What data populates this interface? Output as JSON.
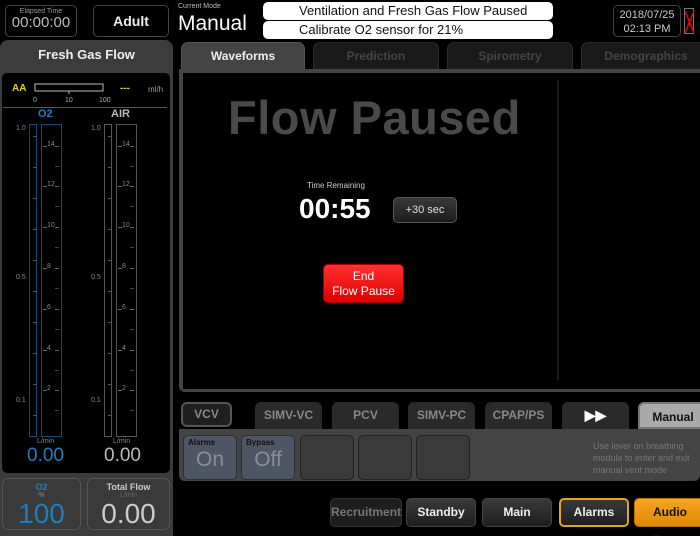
{
  "header": {
    "elapsed_label": "Elapsed Time",
    "elapsed_value": "00:00:00",
    "patient_type": "Adult",
    "mode_label": "Current Mode",
    "mode_value": "Manual",
    "messages": [
      "Ventilation and Fresh Gas Flow Paused",
      "Calibrate O2 sensor for 21%"
    ],
    "date": "2018/07/25",
    "time": "02:13 PM",
    "battery_icon": "battery-missing-icon"
  },
  "fresh_gas_flow": {
    "title": "Fresh Gas Flow",
    "agent": {
      "label": "AA",
      "value": "---",
      "unit": "ml/h",
      "scale_ticks": [
        "0",
        "10",
        "100"
      ]
    },
    "gauges": [
      {
        "name": "O2",
        "color": "#1b7fbf",
        "left_ticks": [
          "1.0",
          "0.5",
          "0.1"
        ],
        "right_ticks": [
          "14",
          "12",
          "10",
          "8",
          "6",
          "4",
          "2"
        ],
        "unit": "L/min",
        "value": "0.00"
      },
      {
        "name": "AIR",
        "color": "#bbbbbb",
        "left_ticks": [
          "1.0",
          "0.5",
          "0.1"
        ],
        "right_ticks": [
          "14",
          "12",
          "10",
          "8",
          "6",
          "4",
          "2"
        ],
        "unit": "L/min",
        "value": "0.00"
      }
    ],
    "o2_percent": {
      "title": "O2",
      "unit": "%",
      "value": "100"
    },
    "total_flow": {
      "title": "Total Flow",
      "unit": "L/min",
      "value": "0.00"
    }
  },
  "tabs": [
    {
      "label": "Waveforms",
      "active": true
    },
    {
      "label": "Prediction",
      "active": false
    },
    {
      "label": "Spirometry",
      "active": false
    },
    {
      "label": "Demographics",
      "active": false
    }
  ],
  "main": {
    "title": "Flow Paused",
    "time_remaining_label": "Time Remaining",
    "time_remaining": "00:55",
    "add_time_label": "+30 sec",
    "end_button_line1": "End",
    "end_button_line2": "Flow Pause"
  },
  "mode_tabs": [
    "VCV",
    "SIMV-VC",
    "PCV",
    "SIMV-PC",
    "CPAP/PS",
    "▶▶",
    "Manual"
  ],
  "settings": [
    {
      "label": "Alarms",
      "value": "On"
    },
    {
      "label": "Bypass",
      "value": "Off"
    },
    {
      "label": "",
      "value": ""
    },
    {
      "label": "",
      "value": ""
    },
    {
      "label": "",
      "value": ""
    }
  ],
  "hint": "Use lever on breathing module to enter and exit manual vent mode",
  "bottom_buttons": [
    "Recruitment",
    "Standby",
    "Main",
    "Alarms",
    "Audio Pause"
  ]
}
